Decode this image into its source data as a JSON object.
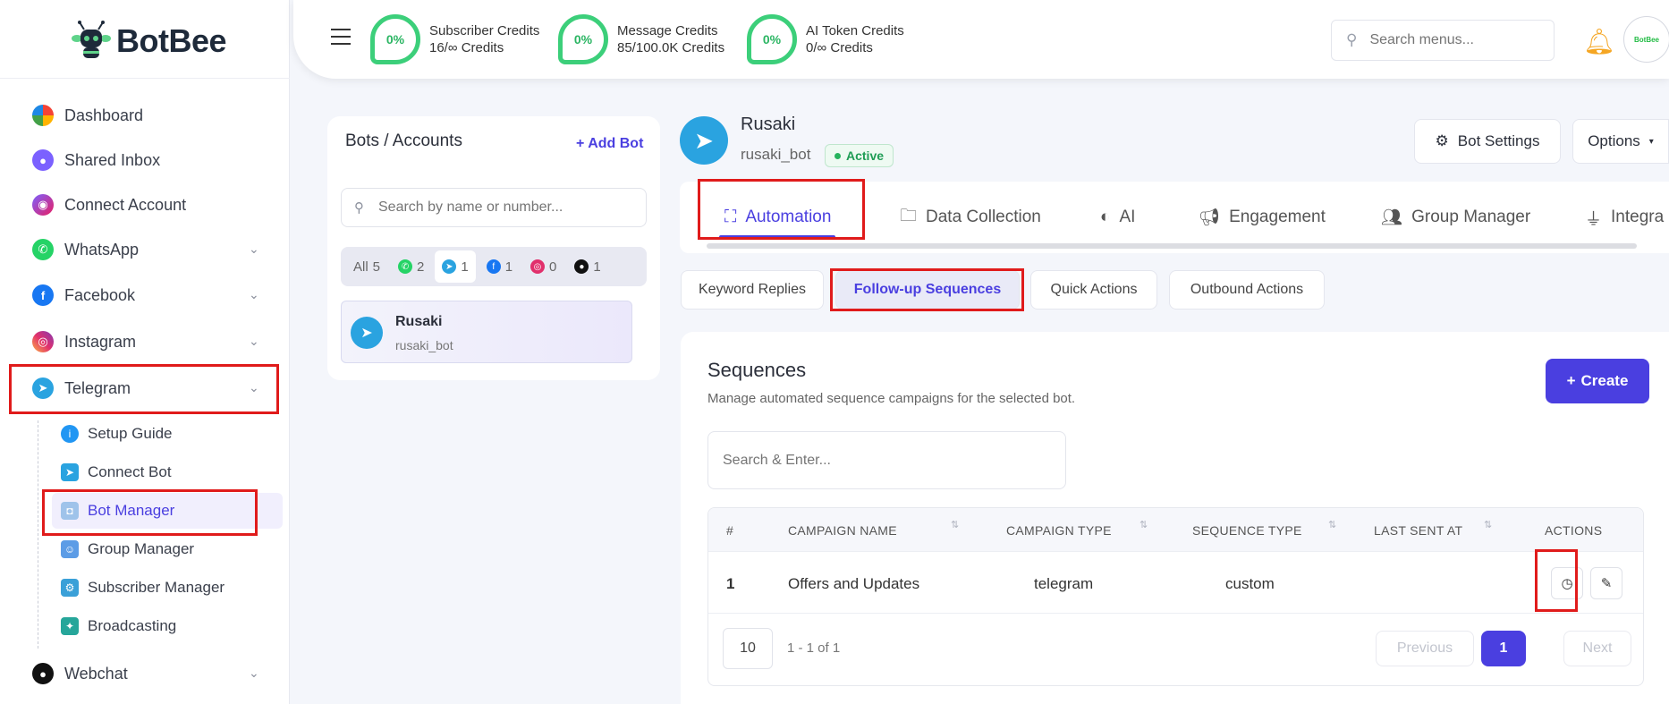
{
  "app": {
    "logo_text": "BotBee"
  },
  "sidebar": {
    "items": [
      {
        "label": "Dashboard"
      },
      {
        "label": "Shared Inbox"
      },
      {
        "label": "Connect Account"
      },
      {
        "label": "WhatsApp"
      },
      {
        "label": "Facebook"
      },
      {
        "label": "Instagram"
      },
      {
        "label": "Telegram"
      },
      {
        "label": "Webchat"
      }
    ],
    "telegram_sub": [
      {
        "label": "Setup Guide"
      },
      {
        "label": "Connect Bot"
      },
      {
        "label": "Bot Manager"
      },
      {
        "label": "Group Manager"
      },
      {
        "label": "Subscriber Manager"
      },
      {
        "label": "Broadcasting"
      }
    ]
  },
  "header": {
    "credits": [
      {
        "percent": "0%",
        "title": "Subscriber Credits",
        "value": "16/∞ Credits"
      },
      {
        "percent": "0%",
        "title": "Message Credits",
        "value": "85/100.0K Credits"
      },
      {
        "percent": "0%",
        "title": "AI Token Credits",
        "value": "0/∞ Credits"
      }
    ],
    "search_placeholder": "Search menus...",
    "avatar_text": "BotBee"
  },
  "bots_panel": {
    "title": "Bots / Accounts",
    "add_label": "Add Bot",
    "search_placeholder": "Search by name or number...",
    "filters": [
      {
        "label": "All",
        "count": "5"
      },
      {
        "icon": "whatsapp-icon",
        "count": "2"
      },
      {
        "icon": "telegram-icon",
        "count": "1"
      },
      {
        "icon": "facebook-icon",
        "count": "1"
      },
      {
        "icon": "instagram-icon",
        "count": "0"
      },
      {
        "icon": "webchat-icon",
        "count": "1"
      }
    ],
    "bot": {
      "name": "Rusaki",
      "handle": "rusaki_bot"
    }
  },
  "bot": {
    "name": "Rusaki",
    "handle": "rusaki_bot",
    "status": "Active",
    "settings_label": "Bot Settings",
    "options_label": "Options"
  },
  "tabs": [
    {
      "label": "Automation"
    },
    {
      "label": "Data Collection"
    },
    {
      "label": "AI"
    },
    {
      "label": "Engagement"
    },
    {
      "label": "Group Manager"
    },
    {
      "label": "Integra"
    }
  ],
  "subtabs": [
    {
      "label": "Keyword Replies"
    },
    {
      "label": "Follow-up Sequences"
    },
    {
      "label": "Quick Actions"
    },
    {
      "label": "Outbound Actions"
    }
  ],
  "sequences": {
    "title": "Sequences",
    "description": "Manage automated sequence campaigns for the selected bot.",
    "create_label": "Create",
    "search_placeholder": "Search & Enter...",
    "columns": [
      "#",
      "CAMPAIGN NAME",
      "CAMPAIGN TYPE",
      "SEQUENCE TYPE",
      "LAST SENT AT",
      "ACTIONS"
    ],
    "rows": [
      {
        "index": "1",
        "name": "Offers and Updates",
        "campaign_type": "telegram",
        "sequence_type": "custom",
        "last_sent": ""
      }
    ],
    "per_page": "10",
    "page_info": "1 - 1 of 1",
    "prev_label": "Previous",
    "next_label": "Next",
    "current_page": "1"
  },
  "colors": {
    "accent": "#4a3fe0",
    "highlight": "#e01b1b",
    "success": "#3ccf7a"
  }
}
